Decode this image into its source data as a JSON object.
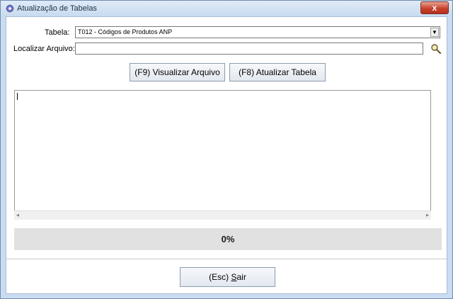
{
  "window": {
    "title": "Atualização de Tabelas",
    "close_glyph": "x"
  },
  "form": {
    "tabela_label": "Tabela:",
    "tabela_value": "T012  - Códigos de Produtos ANP",
    "dropdown_glyph": "▼",
    "localizar_label": "Localizar Arquivo:",
    "localizar_value": ""
  },
  "buttons": {
    "visualizar": "(F9) Visualizar Arquivo",
    "atualizar": "(F8) Atualizar Tabela",
    "sair_prefix": "(Esc) ",
    "sair_mnemonic": "S",
    "sair_rest": "air"
  },
  "memo": {
    "content": "",
    "scroll_left_glyph": "◂",
    "scroll_right_glyph": "▸"
  },
  "progress": {
    "fraction": 0,
    "label": "0%",
    "fill_color": "#4b9b4b"
  },
  "icons": {
    "app": "app-gear-icon",
    "search": "search-icon"
  }
}
